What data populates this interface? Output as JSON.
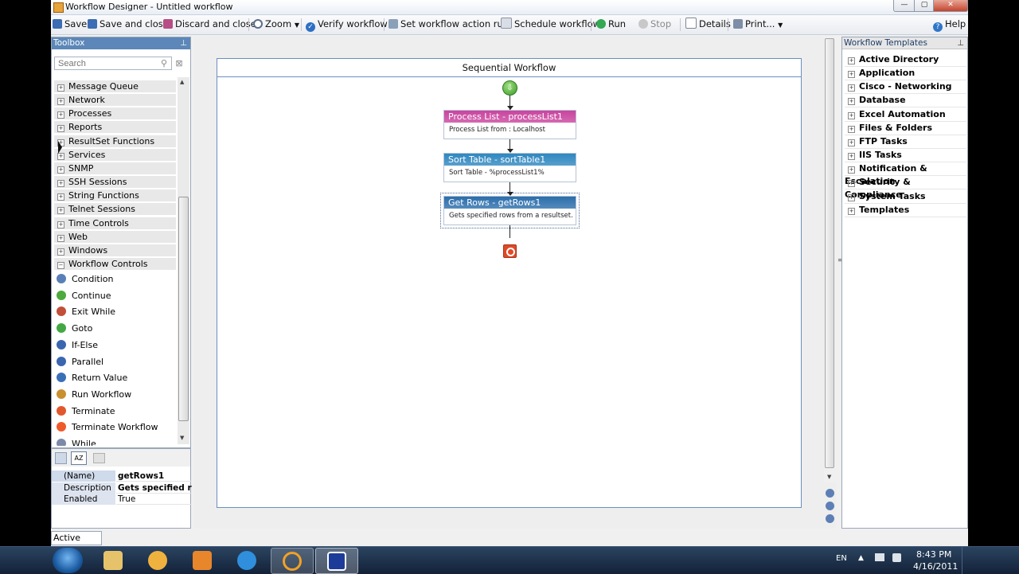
{
  "window": {
    "title": "Workflow Designer - Untitled workflow"
  },
  "toolbar": {
    "save": "Save",
    "save_close": "Save and close",
    "discard_close": "Discard and close",
    "zoom": "Zoom",
    "verify": "Verify workflow",
    "set_rule": "Set workflow action rule",
    "schedule": "Schedule workflow",
    "run": "Run",
    "stop": "Stop",
    "details": "Details",
    "print": "Print...",
    "help": "Help"
  },
  "toolbox": {
    "title": "Toolbox",
    "search_placeholder": "Search",
    "categories": [
      "Message Queue",
      "Network",
      "Processes",
      "Reports",
      "ResultSet Functions",
      "Services",
      "SNMP",
      "SSH Sessions",
      "String Functions",
      "Telnet Sessions",
      "Time Controls",
      "Web",
      "Windows",
      "Workflow Controls"
    ],
    "items": [
      "Condition",
      "Continue",
      "Exit While",
      "Goto",
      "If-Else",
      "Parallel",
      "Return Value",
      "Run Workflow",
      "Terminate",
      "Terminate Workflow",
      "While"
    ],
    "item_colors": [
      "#5a7fb8",
      "#4caa3e",
      "#c14f3a",
      "#43a843",
      "#3a66b0",
      "#3a66b0",
      "#3a6fb8",
      "#c9902f",
      "#e2572d",
      "#ef5a2a",
      "#7a8aa8"
    ]
  },
  "properties": {
    "rows": [
      {
        "key": "(Name)",
        "value": "getRows1"
      },
      {
        "key": "Description",
        "value": "Gets specified rows"
      },
      {
        "key": "Enabled",
        "value": "True"
      }
    ]
  },
  "active_logs": "Active Logs",
  "designer": {
    "title": "Sequential Workflow",
    "activities": [
      {
        "title": "Process List - processList1",
        "desc": "Process List from : Localhost",
        "color": "#c9449e"
      },
      {
        "title": "Sort Table - sortTable1",
        "desc": "Sort Table - %processList1%",
        "color": "#2f87c0"
      },
      {
        "title": "Get Rows - getRows1",
        "desc": "Gets specified rows from a resultset.",
        "color": "#2b6eab"
      }
    ]
  },
  "templates": {
    "title": "Workflow Templates",
    "items": [
      "Active Directory",
      "Application",
      "Cisco - Networking",
      "Database",
      "Excel Automation",
      "Files & Folders",
      "FTP Tasks",
      "IIS Tasks",
      "Notification & Escalation",
      "Security & Compliance",
      "System Tasks",
      "Templates"
    ]
  },
  "taskbar": {
    "lang": "EN",
    "time": "8:43 PM",
    "date": "4/16/2011"
  }
}
